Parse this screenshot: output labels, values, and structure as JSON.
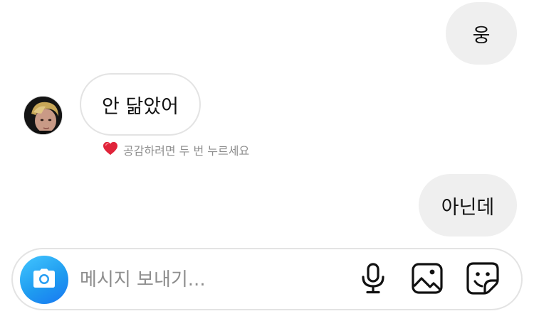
{
  "conversation": {
    "messages": [
      {
        "direction": "sent",
        "text": "웅"
      },
      {
        "direction": "received",
        "text": "안 닮았어"
      },
      {
        "direction": "sent",
        "text": "아닌데"
      }
    ],
    "like_hint": {
      "icon": "heart-icon",
      "text": "공감하려면 두 번 누르세요"
    }
  },
  "composer": {
    "placeholder": "메시지 보내기...",
    "value": "",
    "icons": {
      "camera": "camera-icon",
      "microphone": "microphone-icon",
      "gallery": "image-icon",
      "sticker": "sticker-icon"
    }
  },
  "colors": {
    "sent_bubble": "#efefef",
    "received_border": "#e3e3e3",
    "camera_gradient_start": "#43c6ff",
    "camera_gradient_end": "#1877f2",
    "heart": "#e0243a",
    "hint_text": "#8e8e8e"
  }
}
